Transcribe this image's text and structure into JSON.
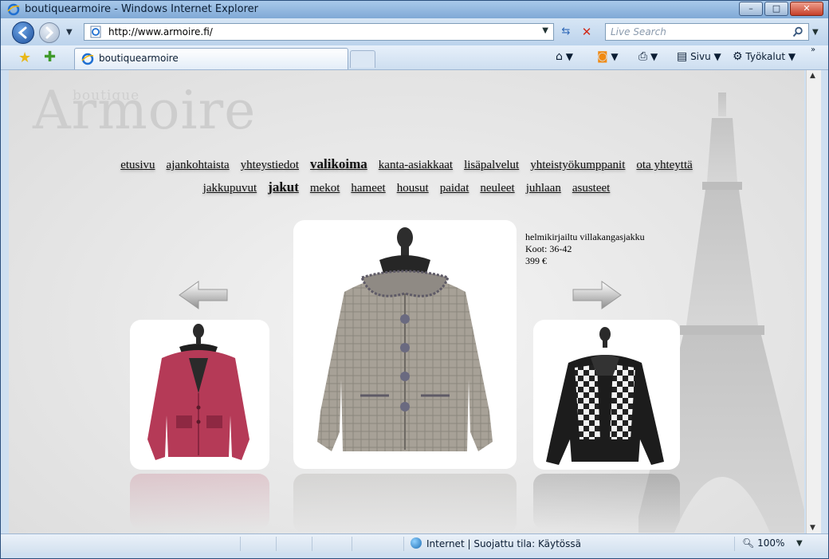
{
  "window": {
    "title": "boutiquearmoire - Windows Internet Explorer",
    "minimize": "–",
    "maximize": "□",
    "close": "✕"
  },
  "address": {
    "url": "http://www.armoire.fi/",
    "search_placeholder": "Live Search"
  },
  "tabs": [
    {
      "label": "boutiquearmoire"
    }
  ],
  "commands": {
    "page": "Sivu",
    "tools": "Työkalut"
  },
  "site": {
    "logo_script": "boutique",
    "logo_main": "Armoire",
    "nav_main": [
      {
        "label": "etusivu"
      },
      {
        "label": "ajankohtaista"
      },
      {
        "label": "yhteystiedot"
      },
      {
        "label": "valikoima",
        "active": true
      },
      {
        "label": "kanta-asiakkaat"
      },
      {
        "label": "lisäpalvelut"
      },
      {
        "label": "yhteistyökumppanit"
      },
      {
        "label": "ota yhteyttä"
      }
    ],
    "nav_sub": [
      {
        "label": "jakkupuvut"
      },
      {
        "label": "jakut",
        "active": true
      },
      {
        "label": "mekot"
      },
      {
        "label": "hameet"
      },
      {
        "label": "housut"
      },
      {
        "label": "paidat"
      },
      {
        "label": "neuleet"
      },
      {
        "label": "juhlaan"
      },
      {
        "label": "asusteet"
      }
    ],
    "product": {
      "name": "helmikirjailtu villakangasjakku",
      "sizes": "Koot: 36-42",
      "price": "399 €"
    }
  },
  "status": {
    "zone": "Internet | Suojattu tila: Käytössä",
    "zoom": "100%"
  },
  "colors": {
    "pink_jacket": "#b53a57",
    "tweed_jacket": "#a7a197",
    "black_jacket": "#1c1c1c"
  }
}
